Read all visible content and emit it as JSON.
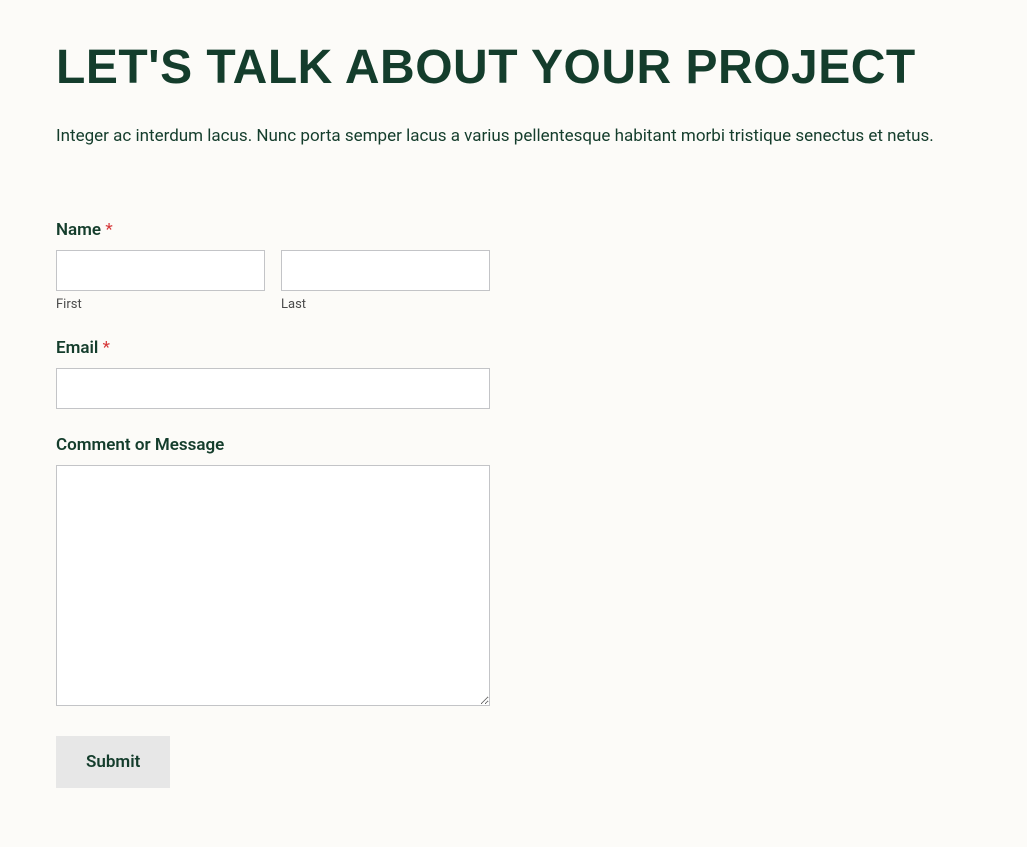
{
  "header": {
    "title": "Let's talk about your project",
    "intro": "Integer ac interdum lacus. Nunc porta semper lacus a varius pellentesque habitant morbi tristique senectus et netus."
  },
  "form": {
    "name": {
      "label": "Name",
      "required_marker": "*",
      "first": {
        "sublabel": "First",
        "value": ""
      },
      "last": {
        "sublabel": "Last",
        "value": ""
      }
    },
    "email": {
      "label": "Email",
      "required_marker": "*",
      "value": ""
    },
    "message": {
      "label": "Comment or Message",
      "value": ""
    },
    "submit_label": "Submit"
  }
}
